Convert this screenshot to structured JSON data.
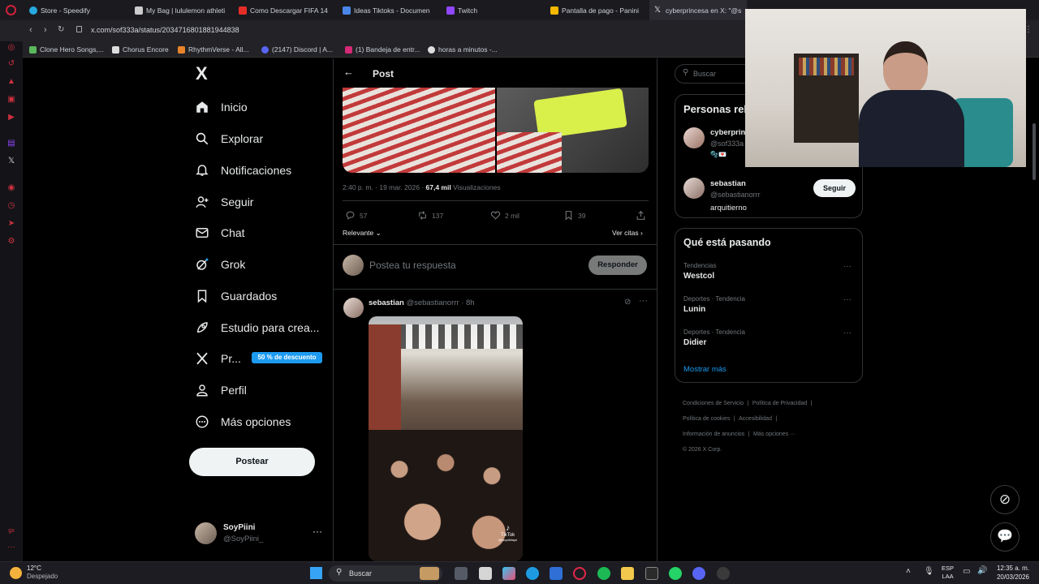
{
  "browser": {
    "tabs": [
      {
        "label": "Store - Speedify",
        "color": "#27a9e0"
      },
      {
        "label": "My Bag | lululemon athleti",
        "color": "#cccccc"
      },
      {
        "label": "Como Descargar FIFA 14",
        "color": "#e52d27"
      },
      {
        "label": "Ideas Tiktoks - Documen",
        "color": "#4a86e8"
      },
      {
        "label": "Twitch",
        "color": "#9146ff"
      },
      {
        "label": "Pantalla de pago - Panini",
        "color": "#f5b700"
      },
      {
        "label": "cyberprincesa en X: \"@s",
        "color": "#e7e9ea"
      }
    ],
    "url": "x.com/sof333a/status/2034716801881944838",
    "bookmarks": [
      {
        "label": "Clone Hero Songs,...",
        "color": "#5cb85c"
      },
      {
        "label": "Chorus Encore",
        "color": "#dddddd"
      },
      {
        "label": "RhythmVerse - All...",
        "color": "#e8832a"
      },
      {
        "label": "(2147) Discord | A...",
        "color": "#5865f2"
      },
      {
        "label": "(1) Bandeja de entr...",
        "color": "#d62976"
      },
      {
        "label": "horas a minutos -...",
        "color": "#dddddd"
      }
    ]
  },
  "sidebar": {
    "logo": "X",
    "items": [
      {
        "label": "Inicio",
        "icon": "home-icon"
      },
      {
        "label": "Explorar",
        "icon": "search-icon"
      },
      {
        "label": "Notificaciones",
        "icon": "bell-icon"
      },
      {
        "label": "Seguir",
        "icon": "add-person-icon"
      },
      {
        "label": "Chat",
        "icon": "mail-icon"
      },
      {
        "label": "Grok",
        "icon": "grok-icon"
      },
      {
        "label": "Guardados",
        "icon": "bookmark-icon"
      },
      {
        "label": "Estudio para crea...",
        "icon": "rocket-icon"
      },
      {
        "label": "Pr...",
        "icon": "x-premium-icon"
      },
      {
        "label": "Perfil",
        "icon": "person-icon"
      },
      {
        "label": "Más opciones",
        "icon": "more-circle-icon"
      }
    ],
    "premium_badge": "50 % de descuento",
    "post_button": "Postear",
    "account": {
      "name": "SoyPiini",
      "handle": "@SoyPiini_"
    }
  },
  "post": {
    "header_title": "Post",
    "meta_time": "2:40 p. m. · 19 mar. 2026 · ",
    "meta_views_count": "67,4 mil",
    "meta_views_label": "Visualizaciones",
    "stats": {
      "replies": "57",
      "reposts": "137",
      "likes": "2 mil",
      "bookmarks": "39"
    },
    "sort_label": "Relevante",
    "quotes_link": "Ver citas",
    "reply_placeholder": "Postea tu respuesta",
    "reply_button": "Responder",
    "reply": {
      "name": "sebastian",
      "handle": "@sebastianorrr",
      "time": "· 8h",
      "video_watermark": "TikTok",
      "video_user": "@toquibilaye"
    }
  },
  "right": {
    "search_placeholder": "Buscar",
    "who_to_follow_title": "Personas rel",
    "people": [
      {
        "name": "cyberprin",
        "handle": "@sof333a",
        "bio": ""
      },
      {
        "name": "sebastian",
        "handle": "@sebastianorrr",
        "bio": "arquitierno",
        "follow_label": "Seguir"
      }
    ],
    "trends_title": "Qué está pasando",
    "trends": [
      {
        "category": "Tendencias",
        "name": "Westcol"
      },
      {
        "category": "Deportes · Tendencia",
        "name": "Lunin"
      },
      {
        "category": "Deportes · Tendencia",
        "name": "Didier"
      }
    ],
    "show_more": "Mostrar más",
    "footer": [
      "Condiciones de Servicio",
      "Política de Privacidad",
      "Política de cookies",
      "Accesibilidad",
      "Información de anuncios",
      "Más opciones ···",
      "© 2026 X Corp."
    ]
  },
  "taskbar": {
    "weather_temp": "12°C",
    "weather_desc": "Despejado",
    "search_label": "Buscar",
    "lang_top": "ESP",
    "lang_bottom": "LAA",
    "time": "12:35 a. m.",
    "date": "20/03/2026"
  }
}
